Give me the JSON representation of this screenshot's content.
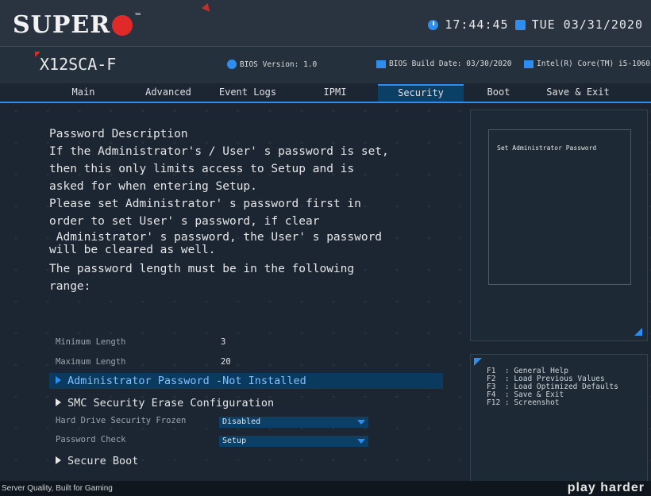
{
  "header": {
    "logo_text": "SUPER",
    "logo_tm": "™",
    "time": "17:44:45",
    "date": "TUE 03/31/2020"
  },
  "info": {
    "board": "X12SCA-F",
    "bios_version": "BIOS Version: 1.0",
    "build_date": "BIOS Build Date: 03/30/2020",
    "cpu": "Intel(R) Core(TM) i5-1060"
  },
  "tabs": [
    {
      "label": "Main"
    },
    {
      "label": "Advanced"
    },
    {
      "label": "Event Logs"
    },
    {
      "label": "IPMI"
    },
    {
      "label": "Security"
    },
    {
      "label": "Boot"
    },
    {
      "label": "Save & Exit"
    }
  ],
  "active_tab": "Security",
  "description": {
    "lines": [
      "Password Description",
      "If the Administrator's / User' s password is set,",
      "then this only limits access to Setup and is",
      "asked for when entering Setup.",
      "Please set Administrator' s password first in",
      "order to set User' s password, if clear",
      " Administrator' s password, the User' s password",
      "will be cleared as well.",
      "The password length must be in the following",
      "range:"
    ]
  },
  "settings": {
    "min_label": "Minimum Length",
    "min_value": "3",
    "max_label": "Maximum Length",
    "max_value": "20",
    "admin_password": "Administrator Password -Not Installed",
    "smc_erase": "SMC Security Erase Configuration",
    "hdd_frozen_label": "Hard Drive Security Frozen",
    "hdd_frozen_value": "Disabled",
    "password_check_label": "Password Check",
    "password_check_value": "Setup",
    "secure_boot": "Secure Boot"
  },
  "help": {
    "text": "Set Administrator Password",
    "keys": "F1  : General Help\nF2  : Load Previous Values\nF3  : Load Optimized Defaults\nF4  : Save & Exit\nF12 : Screenshot"
  },
  "footer": {
    "left": "Server Quality, Built for Gaming",
    "right": "play harder"
  },
  "colors": {
    "accent": "#2d8ef0",
    "brand_red": "#e02a2a",
    "selection": "#0b3a5f"
  }
}
